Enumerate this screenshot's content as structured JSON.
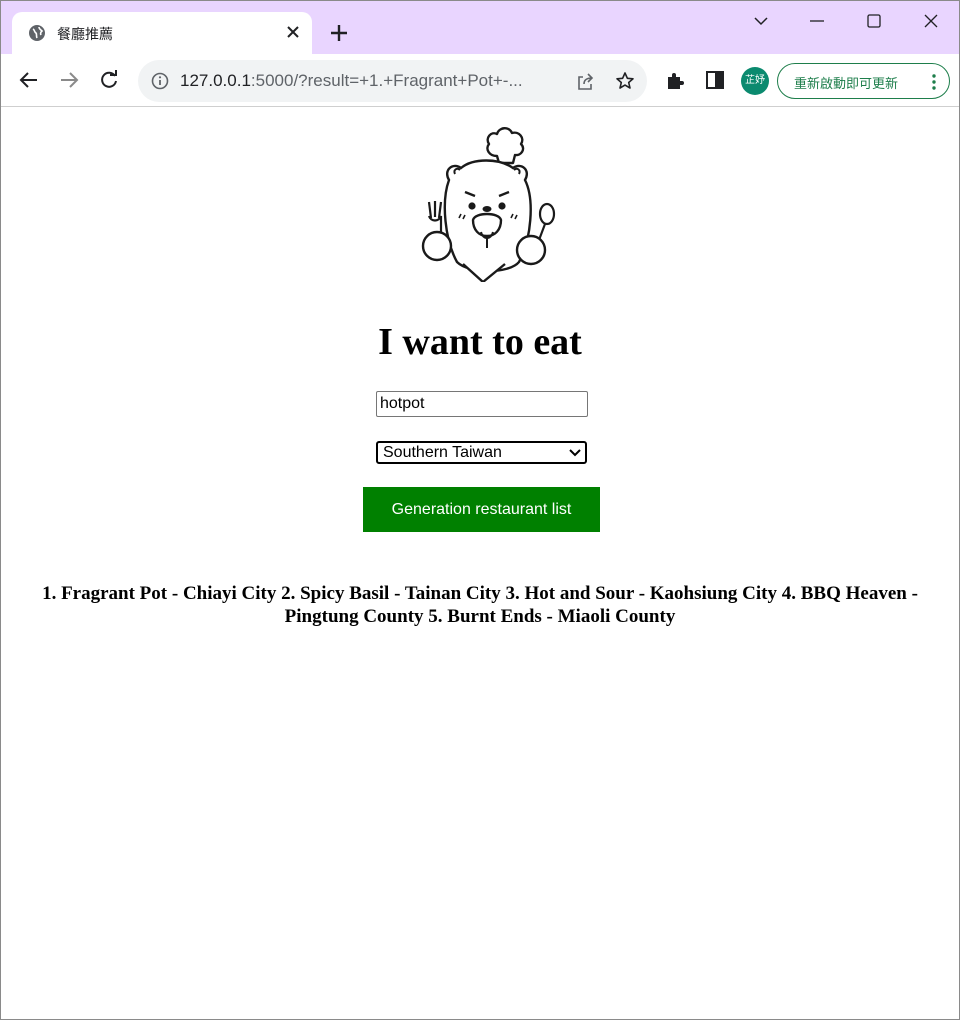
{
  "browser": {
    "tab": {
      "title": "餐廳推薦",
      "favicon": "globe-icon"
    },
    "omnibox": {
      "url_host": "127.0.0.1",
      "url_rest": ":5000/?result=+1.+Fragrant+Pot+-..."
    },
    "profile_avatar_text": "芷妤",
    "update_button_label": "重新啟動即可更新",
    "colors": {
      "tabstrip": "#e9d5ff",
      "update_accent": "#1e7e4b",
      "avatar": "#0b8a6f"
    }
  },
  "page": {
    "logo": "chef-bear-mascot-icon",
    "heading": "I want to eat",
    "food_input": {
      "value": "hotpot"
    },
    "region_select": {
      "selected": "Southern Taiwan"
    },
    "generate_button_label": "Generation restaurant list",
    "result_text": "1. Fragrant Pot - Chiayi City 2. Spicy Basil - Tainan City 3. Hot and Sour - Kaohsiung City 4. BBQ Heaven - Pingtung County 5. Burnt Ends - Miaoli County",
    "colors": {
      "button": "#008000"
    }
  }
}
